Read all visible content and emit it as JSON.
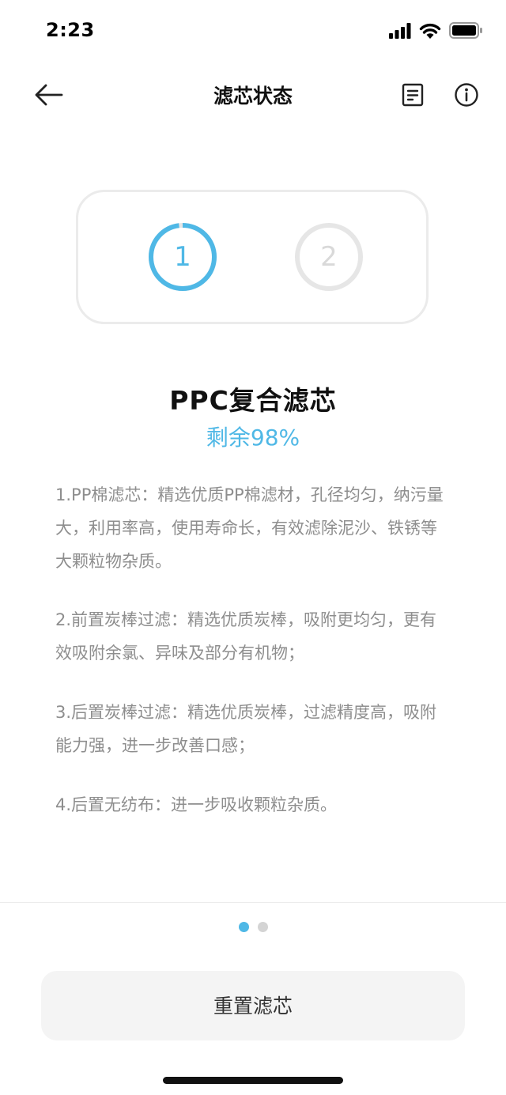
{
  "status_bar": {
    "time": "2:23"
  },
  "header": {
    "title": "滤芯状态"
  },
  "filters": [
    {
      "label": "1",
      "remaining_fraction": 0.98,
      "selected": true
    },
    {
      "label": "2",
      "remaining_fraction": 0,
      "selected": false
    }
  ],
  "filter_info": {
    "name": "PPC复合滤芯",
    "remaining": "剩余98%"
  },
  "descriptions": [
    "1.PP棉滤芯：精选优质PP棉滤材，孔径均匀，纳污量大，利用率高，使用寿命长，有效滤除泥沙、铁锈等大颗粒物杂质。",
    "2.前置炭棒过滤：精选优质炭棒，吸附更均匀，更有效吸附余氯、异味及部分有机物；",
    "3.后置炭棒过滤：精选优质炭棒，过滤精度高，吸附能力强，进一步改善口感；",
    "4.后置无纺布：进一步吸收颗粒杂质。"
  ],
  "pagination": {
    "current": 1,
    "total": 2
  },
  "actions": {
    "reset_label": "重置滤芯"
  },
  "colors": {
    "accent": "#4fb8e6",
    "inactive": "#e6e6e6",
    "text_secondary": "#8e8e8e"
  },
  "icons": {
    "back": "arrow-left-icon",
    "document": "document-icon",
    "info": "info-icon",
    "signal": "cellular-signal-icon",
    "wifi": "wifi-icon",
    "battery": "battery-icon"
  }
}
